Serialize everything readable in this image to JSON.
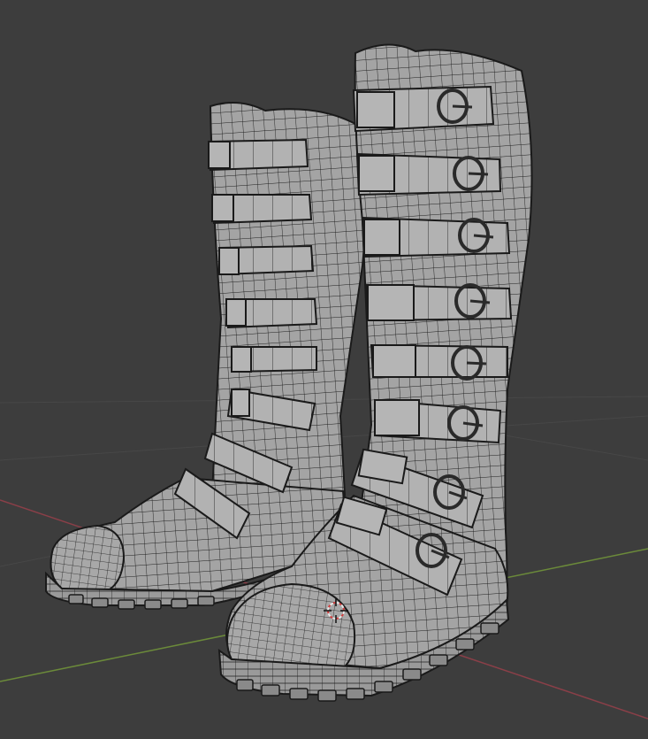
{
  "viewport": {
    "background": "#3d3d3d",
    "grid_color": "#474747",
    "x_axis_color": "#8a3f48",
    "y_axis_color": "#6b8a3a"
  },
  "scene": {
    "objects": [
      {
        "name": "left-boot",
        "strap_count": 8,
        "buckles_visible": false
      },
      {
        "name": "right-boot",
        "strap_count": 8,
        "buckles_visible": true
      }
    ],
    "mesh_color": "#a3a3a3",
    "wire_color": "#1e1e1e",
    "cursor_icon": "3d-cursor-icon"
  }
}
